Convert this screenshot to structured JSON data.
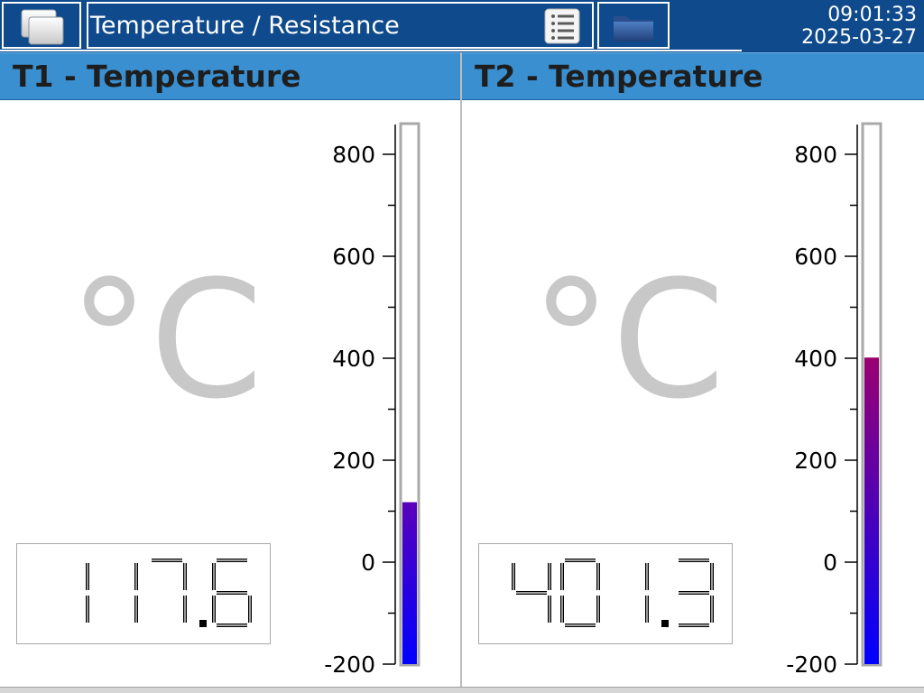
{
  "header": {
    "title": "Temperature / Resistance",
    "time": "09:01:33",
    "date": "2025-03-27",
    "menu_icon": "windows-stack-icon",
    "list_icon": "list-icon",
    "folder_icon": "folder-icon"
  },
  "scale": {
    "min": -200,
    "max": 800,
    "tick_labels": [
      "800",
      "600",
      "400",
      "200",
      "0",
      "-200"
    ]
  },
  "channels": [
    {
      "title": "T1 - Temperature",
      "unit": "°C",
      "value": "117.6",
      "level": 117.6,
      "bar_color_low": "#0000ff",
      "bar_color_high": "#5a00bb"
    },
    {
      "title": "T2 - Temperature",
      "unit": "°C",
      "value": "401.3",
      "level": 401.3,
      "bar_color_low": "#0000ff",
      "bar_color_high": "#9a0070"
    }
  ]
}
